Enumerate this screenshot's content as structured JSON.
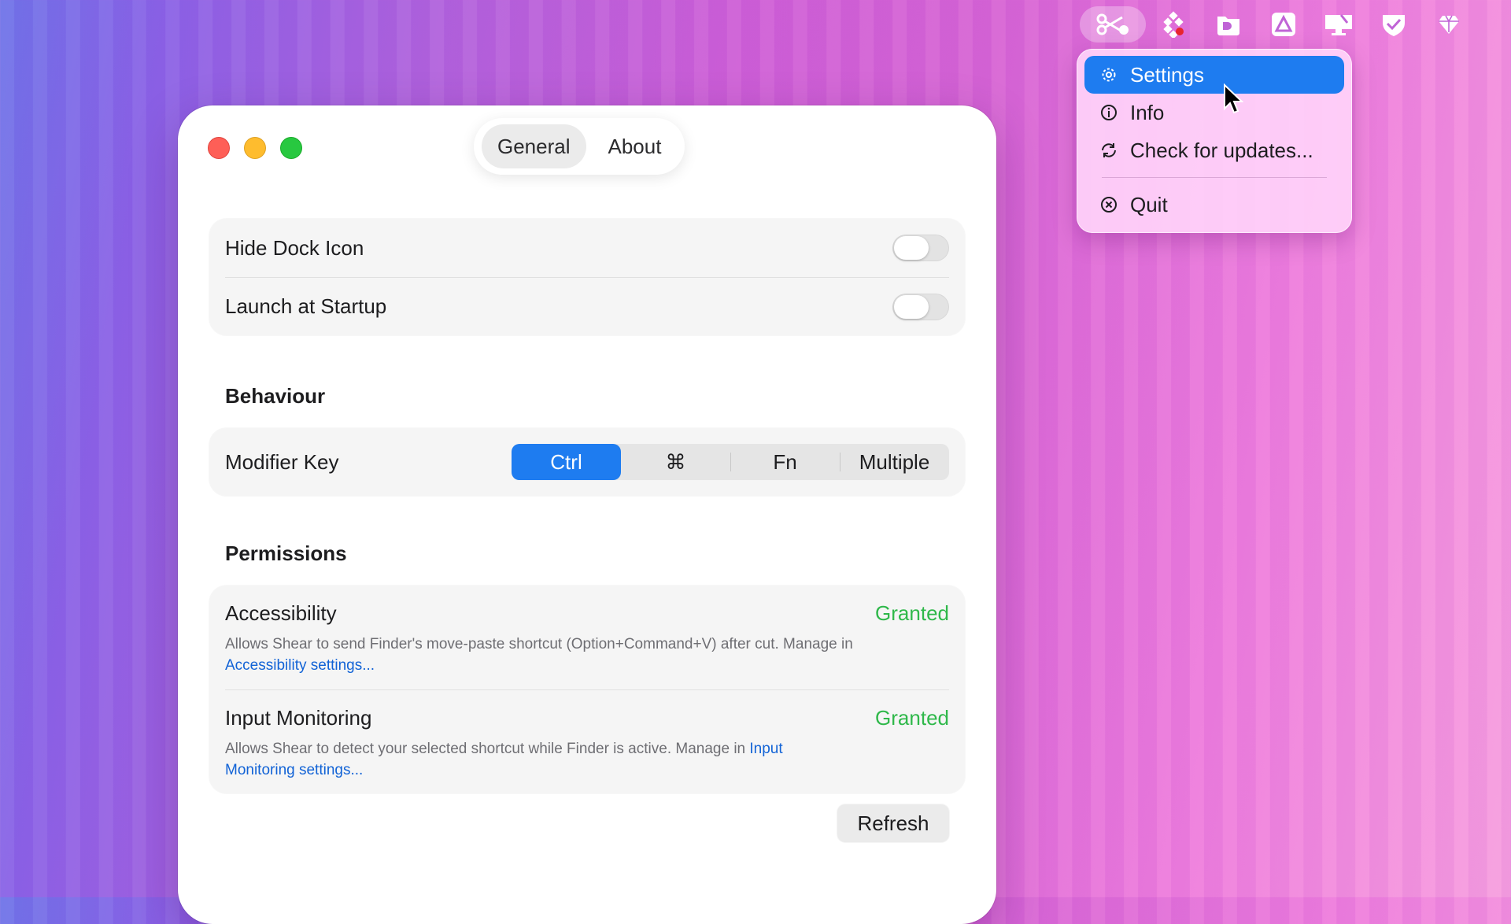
{
  "menubar": {
    "icons": [
      "shear-scissors-icon",
      "dots-grid-icon",
      "folder-badge-icon",
      "drive-triangle-icon",
      "display-icon",
      "shield-check-icon",
      "diamond-icon"
    ]
  },
  "menu": {
    "items": [
      {
        "label": "Settings",
        "icon": "gear-icon"
      },
      {
        "label": "Info",
        "icon": "info-icon"
      },
      {
        "label": "Check for updates...",
        "icon": "refresh-icon"
      },
      {
        "label": "Quit",
        "icon": "close-circle-icon"
      }
    ]
  },
  "window": {
    "tabs": [
      {
        "label": "General"
      },
      {
        "label": "About"
      }
    ],
    "general": {
      "rows": [
        {
          "label": "Hide Dock Icon",
          "toggle": false
        },
        {
          "label": "Launch at Startup",
          "toggle": false
        }
      ]
    },
    "behaviour": {
      "title": "Behaviour",
      "modifier_label": "Modifier Key",
      "options": [
        "Ctrl",
        "⌘",
        "Fn",
        "Multiple"
      ],
      "selected": "Ctrl"
    },
    "permissions": {
      "title": "Permissions",
      "items": [
        {
          "name": "Accessibility",
          "status": "Granted",
          "desc": "Allows Shear to send Finder's move-paste shortcut (Option+Command+V) after cut. Manage in",
          "link": "Accessibility settings..."
        },
        {
          "name": "Input Monitoring",
          "status": "Granted",
          "desc": "Allows Shear to detect your selected shortcut while Finder is active. Manage in",
          "link": "Input Monitoring settings..."
        }
      ],
      "refresh_label": "Refresh"
    }
  },
  "colors": {
    "accent": "#1e7cf0",
    "granted": "#2fb84a",
    "link": "#1263d6"
  }
}
